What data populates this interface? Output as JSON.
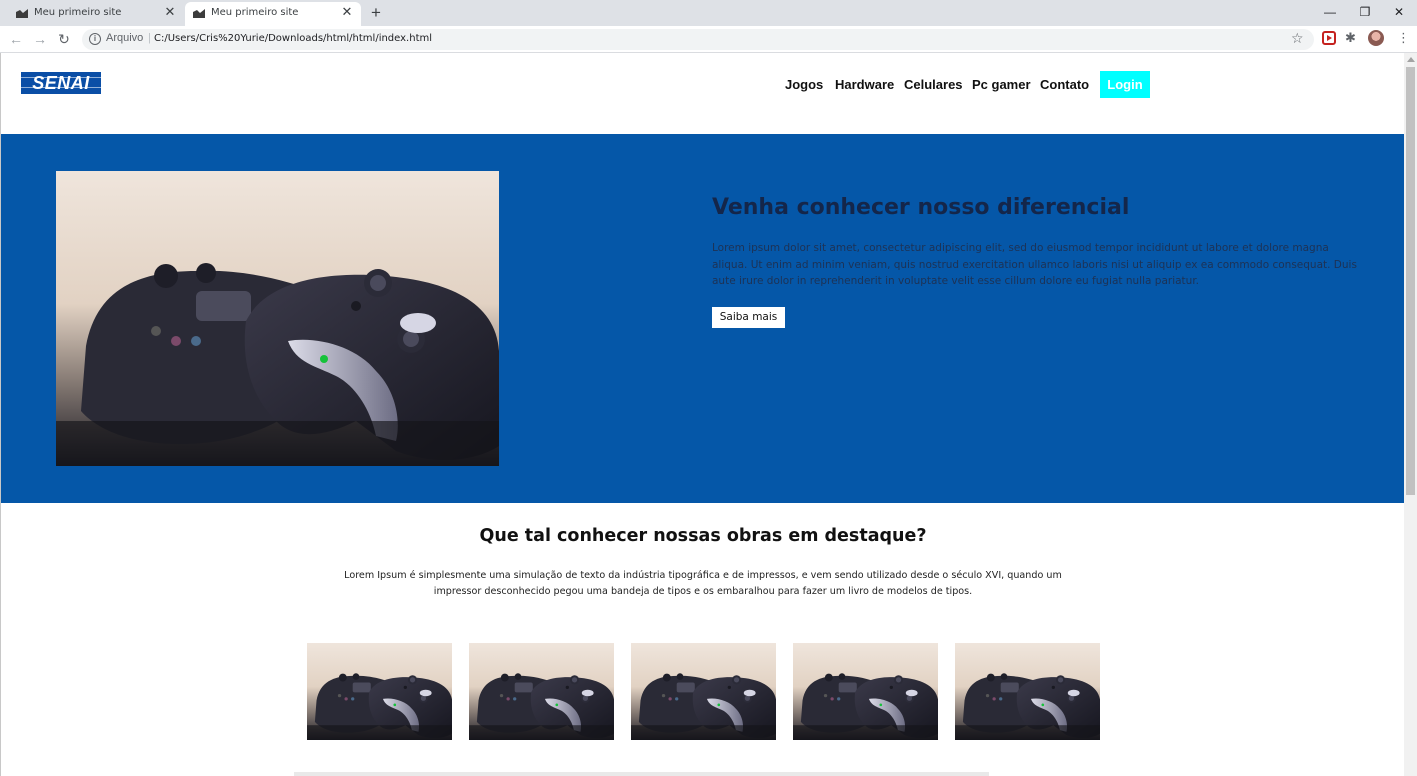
{
  "browser": {
    "tabs": [
      {
        "title": "Meu primeiro site",
        "active": false
      },
      {
        "title": "Meu primeiro site",
        "active": true
      }
    ],
    "address": {
      "scheme_label": "Arquivo",
      "separator": "|",
      "url": "C:/Users/Cris%20Yurie/Downloads/html/html/index.html"
    },
    "icons": {
      "back": "arrow-left-icon",
      "forward": "arrow-right-icon",
      "reload": "reload-icon",
      "info": "info-icon",
      "star": "star-icon",
      "extension": "puzzle-icon",
      "menu": "kebab-menu-icon"
    },
    "window_controls": {
      "minimize": "—",
      "restore": "❐",
      "close": "✕"
    }
  },
  "site": {
    "logo_text": "SENAI",
    "nav": {
      "jogos": "Jogos",
      "hardware": "Hardware",
      "celulares": "Celulares",
      "pcgamer": "Pc gamer",
      "contato": "Contato",
      "login": "Login"
    },
    "hero": {
      "title": "Venha conhecer nosso diferencial",
      "text": "Lorem ipsum dolor sit amet, consectetur adipiscing elit, sed do eiusmod tempor incididunt ut labore et dolore magna aliqua. Ut enim ad minim veniam, quis nostrud exercitation ullamco laboris nisi ut aliquip ex ea commodo consequat. Duis aute irure dolor in reprehenderit in voluptate velit esse cillum dolore eu fugiat nulla pariatur.",
      "button": "Saiba mais"
    },
    "featured": {
      "title": "Que tal conhecer nossas obras em destaque?",
      "text": "Lorem Ipsum é simplesmente uma simulação de texto da indústria tipográfica e de impressos, e vem sendo utilizado desde o século XVI, quando um impressor desconhecido pegou uma bandeja de tipos e os embaralhou para fazer um livro de modelos de tipos."
    }
  },
  "colors": {
    "hero_bg": "#0557a8",
    "login_bg": "#00ffff",
    "logo_bg": "#0a4ea6"
  }
}
